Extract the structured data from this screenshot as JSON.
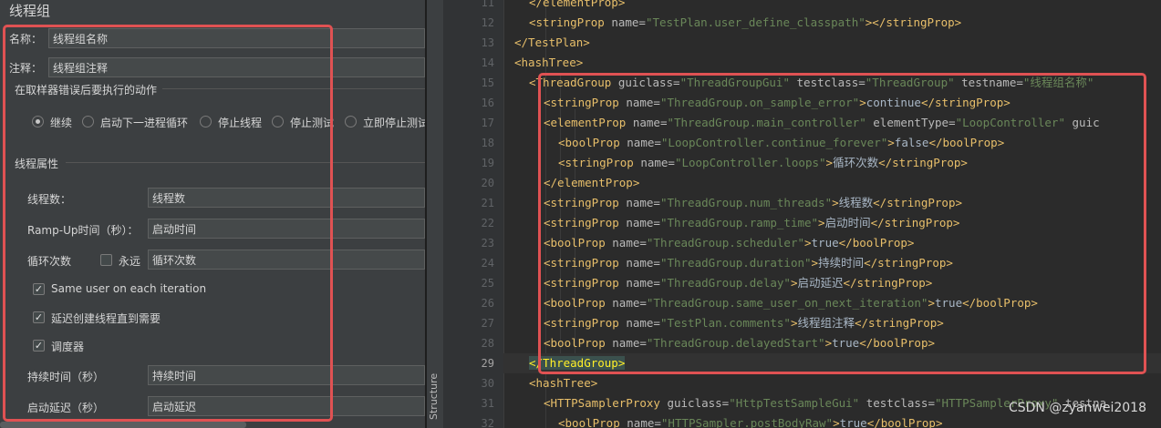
{
  "panel": {
    "title": "线程组",
    "name_label": "名称：",
    "name_value": "线程组名称",
    "comment_label": "注释：",
    "comment_value": "线程组注释",
    "error_section": "在取样器错误后要执行的动作",
    "error_actions": [
      {
        "label": "继续",
        "selected": true
      },
      {
        "label": "启动下一进程循环",
        "selected": false
      },
      {
        "label": "停止线程",
        "selected": false
      },
      {
        "label": "停止测试",
        "selected": false
      },
      {
        "label": "立即停止测试",
        "selected": false
      }
    ],
    "thread_section": "线程属性",
    "threads_label": "线程数：",
    "threads_value": "线程数",
    "rampup_label": "Ramp-Up时间（秒）：",
    "rampup_value": "启动时间",
    "loop_label": "循环次数",
    "forever_label": "永远",
    "forever_checked": false,
    "loop_value": "循环次数",
    "same_user_label": "Same user on each iteration",
    "same_user_checked": true,
    "delay_create_label": "延迟创建线程直到需要",
    "delay_create_checked": true,
    "scheduler_label": "调度器",
    "scheduler_checked": true,
    "duration_label": "持续时间（秒）",
    "duration_value": "持续时间",
    "startup_delay_label": "启动延迟（秒）",
    "startup_delay_value": "启动延迟"
  },
  "editor": {
    "structure_tab": "Structure",
    "current_line": 29,
    "lines": [
      {
        "no": 11,
        "indent": 3,
        "parts": [
          [
            "tag",
            "</elementProp>"
          ]
        ]
      },
      {
        "no": 12,
        "indent": 3,
        "parts": [
          [
            "tag",
            "<stringProp "
          ],
          [
            "an",
            "name="
          ],
          [
            "av",
            "\"TestPlan.user_define_classpath\""
          ],
          [
            "tag",
            "></stringProp>"
          ]
        ]
      },
      {
        "no": 13,
        "indent": 2,
        "parts": [
          [
            "tag",
            "</TestPlan>"
          ]
        ]
      },
      {
        "no": 14,
        "indent": 2,
        "parts": [
          [
            "tag",
            "<hashTree>"
          ]
        ]
      },
      {
        "no": 15,
        "indent": 3,
        "parts": [
          [
            "tag",
            "<ThreadGroup "
          ],
          [
            "an",
            "guiclass="
          ],
          [
            "av",
            "\"ThreadGroupGui\" "
          ],
          [
            "an",
            "testclass="
          ],
          [
            "av",
            "\"ThreadGroup\" "
          ],
          [
            "an",
            "testname="
          ],
          [
            "av",
            "\"线程组名称\""
          ]
        ]
      },
      {
        "no": 16,
        "indent": 4,
        "parts": [
          [
            "tag",
            "<stringProp "
          ],
          [
            "an",
            "name="
          ],
          [
            "av",
            "\"ThreadGroup.on_sample_error\""
          ],
          [
            "tag",
            ">"
          ],
          [
            "tx",
            "continue"
          ],
          [
            "tag",
            "</stringProp>"
          ]
        ]
      },
      {
        "no": 17,
        "indent": 4,
        "parts": [
          [
            "tag",
            "<elementProp "
          ],
          [
            "an",
            "name="
          ],
          [
            "av",
            "\"ThreadGroup.main_controller\" "
          ],
          [
            "an",
            "elementType="
          ],
          [
            "av",
            "\"LoopController\" "
          ],
          [
            "an",
            "guic"
          ]
        ]
      },
      {
        "no": 18,
        "indent": 5,
        "parts": [
          [
            "tag",
            "<boolProp "
          ],
          [
            "an",
            "name="
          ],
          [
            "av",
            "\"LoopController.continue_forever\""
          ],
          [
            "tag",
            ">"
          ],
          [
            "tx",
            "false"
          ],
          [
            "tag",
            "</boolProp>"
          ]
        ]
      },
      {
        "no": 19,
        "indent": 5,
        "parts": [
          [
            "tag",
            "<stringProp "
          ],
          [
            "an",
            "name="
          ],
          [
            "av",
            "\"LoopController.loops\""
          ],
          [
            "tag",
            ">"
          ],
          [
            "tx",
            "循环次数"
          ],
          [
            "tag",
            "</stringProp>"
          ]
        ]
      },
      {
        "no": 20,
        "indent": 4,
        "parts": [
          [
            "tag",
            "</elementProp>"
          ]
        ]
      },
      {
        "no": 21,
        "indent": 4,
        "parts": [
          [
            "tag",
            "<stringProp "
          ],
          [
            "an",
            "name="
          ],
          [
            "av",
            "\"ThreadGroup.num_threads\""
          ],
          [
            "tag",
            ">"
          ],
          [
            "tx",
            "线程数"
          ],
          [
            "tag",
            "</stringProp>"
          ]
        ]
      },
      {
        "no": 22,
        "indent": 4,
        "parts": [
          [
            "tag",
            "<stringProp "
          ],
          [
            "an",
            "name="
          ],
          [
            "av",
            "\"ThreadGroup.ramp_time\""
          ],
          [
            "tag",
            ">"
          ],
          [
            "tx",
            "启动时间"
          ],
          [
            "tag",
            "</stringProp>"
          ]
        ]
      },
      {
        "no": 23,
        "indent": 4,
        "parts": [
          [
            "tag",
            "<boolProp "
          ],
          [
            "an",
            "name="
          ],
          [
            "av",
            "\"ThreadGroup.scheduler\""
          ],
          [
            "tag",
            ">"
          ],
          [
            "tx",
            "true"
          ],
          [
            "tag",
            "</boolProp>"
          ]
        ]
      },
      {
        "no": 24,
        "indent": 4,
        "parts": [
          [
            "tag",
            "<stringProp "
          ],
          [
            "an",
            "name="
          ],
          [
            "av",
            "\"ThreadGroup.duration\""
          ],
          [
            "tag",
            ">"
          ],
          [
            "tx",
            "持续时间"
          ],
          [
            "tag",
            "</stringProp>"
          ]
        ]
      },
      {
        "no": 25,
        "indent": 4,
        "parts": [
          [
            "tag",
            "<stringProp "
          ],
          [
            "an",
            "name="
          ],
          [
            "av",
            "\"ThreadGroup.delay\""
          ],
          [
            "tag",
            ">"
          ],
          [
            "tx",
            "启动延迟"
          ],
          [
            "tag",
            "</stringProp>"
          ]
        ]
      },
      {
        "no": 26,
        "indent": 4,
        "parts": [
          [
            "tag",
            "<boolProp "
          ],
          [
            "an",
            "name="
          ],
          [
            "av",
            "\"ThreadGroup.same_user_on_next_iteration\""
          ],
          [
            "tag",
            ">"
          ],
          [
            "tx",
            "true"
          ],
          [
            "tag",
            "</boolProp>"
          ]
        ]
      },
      {
        "no": 27,
        "indent": 4,
        "parts": [
          [
            "tag",
            "<stringProp "
          ],
          [
            "an",
            "name="
          ],
          [
            "av",
            "\"TestPlan.comments\""
          ],
          [
            "tag",
            ">"
          ],
          [
            "tx",
            "线程组注释"
          ],
          [
            "tag",
            "</stringProp>"
          ]
        ]
      },
      {
        "no": 28,
        "indent": 4,
        "parts": [
          [
            "tag",
            "<boolProp "
          ],
          [
            "an",
            "name="
          ],
          [
            "av",
            "\"ThreadGroup.delayedStart\""
          ],
          [
            "tag",
            ">"
          ],
          [
            "tx",
            "true"
          ],
          [
            "tag",
            "</boolProp>"
          ]
        ]
      },
      {
        "no": 29,
        "indent": 3,
        "parts": [
          [
            "taghl",
            "</ThreadGroup>"
          ]
        ]
      },
      {
        "no": 30,
        "indent": 3,
        "parts": [
          [
            "tag",
            "<hashTree>"
          ]
        ]
      },
      {
        "no": 31,
        "indent": 4,
        "parts": [
          [
            "tag",
            "<HTTPSamplerProxy "
          ],
          [
            "an",
            "guiclass="
          ],
          [
            "av",
            "\"HttpTestSampleGui\" "
          ],
          [
            "an",
            "testclass="
          ],
          [
            "av",
            "\"HTTPSamplerProxy\" "
          ],
          [
            "an",
            "testna"
          ]
        ]
      },
      {
        "no": 32,
        "indent": 5,
        "parts": [
          [
            "tag",
            "<boolProp "
          ],
          [
            "an",
            "name="
          ],
          [
            "av",
            "\"HTTPSampler.postBodyRaw\""
          ],
          [
            "tag",
            ">"
          ],
          [
            "tx",
            "true"
          ],
          [
            "tag",
            "</boolProp>"
          ]
        ]
      }
    ]
  },
  "watermark": "CSDN @zyanwei2018"
}
